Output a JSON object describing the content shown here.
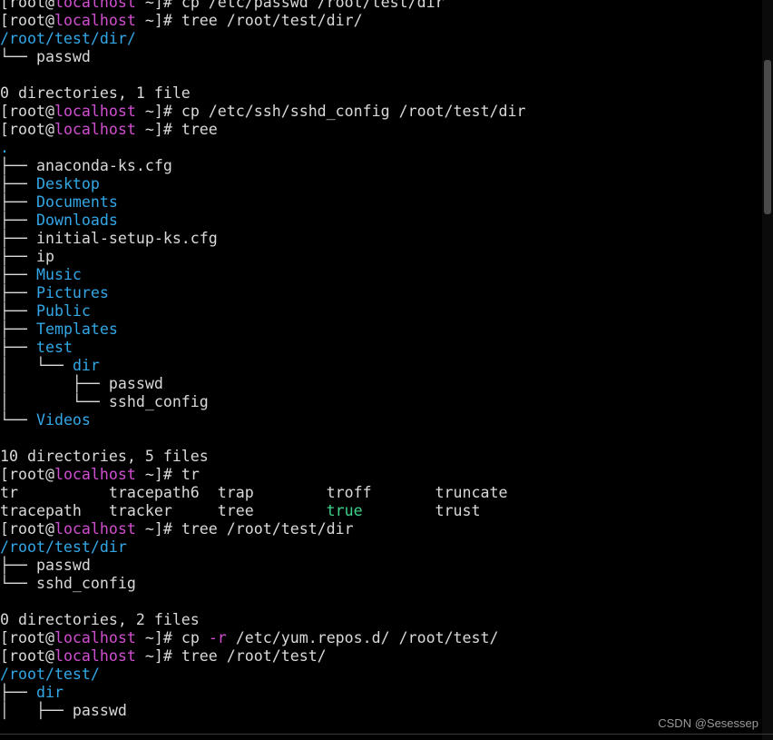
{
  "colors": {
    "default": "#d9d9d9",
    "host": "#d04fd0",
    "dir": "#33a7e6",
    "exec": "#3ed18b"
  },
  "watermark": "CSDN @Sesessep",
  "lines": [
    [
      [
        "[root@",
        "default"
      ],
      [
        "localhost",
        "host"
      ],
      [
        " ~]# cp /etc/passwd /root/test/dir",
        "default"
      ]
    ],
    [
      [
        "[root@",
        "default"
      ],
      [
        "localhost",
        "host"
      ],
      [
        " ~]# tree /root/test/dir/",
        "default"
      ]
    ],
    [
      [
        "/root/test/dir/",
        "dir"
      ]
    ],
    [
      [
        "└── passwd",
        "default"
      ]
    ],
    [
      [
        "",
        "default"
      ]
    ],
    [
      [
        "0 directories, 1 file",
        "default"
      ]
    ],
    [
      [
        "[root@",
        "default"
      ],
      [
        "localhost",
        "host"
      ],
      [
        " ~]# cp /etc/ssh/sshd_config /root/test/dir",
        "default"
      ]
    ],
    [
      [
        "[root@",
        "default"
      ],
      [
        "localhost",
        "host"
      ],
      [
        " ~]# tree",
        "default"
      ]
    ],
    [
      [
        ".",
        "dir"
      ]
    ],
    [
      [
        "├── anaconda-ks.cfg",
        "default"
      ]
    ],
    [
      [
        "├── ",
        "default"
      ],
      [
        "Desktop",
        "dir"
      ]
    ],
    [
      [
        "├── ",
        "default"
      ],
      [
        "Documents",
        "dir"
      ]
    ],
    [
      [
        "├── ",
        "default"
      ],
      [
        "Downloads",
        "dir"
      ]
    ],
    [
      [
        "├── initial-setup-ks.cfg",
        "default"
      ]
    ],
    [
      [
        "├── ip",
        "default"
      ]
    ],
    [
      [
        "├── ",
        "default"
      ],
      [
        "Music",
        "dir"
      ]
    ],
    [
      [
        "├── ",
        "default"
      ],
      [
        "Pictures",
        "dir"
      ]
    ],
    [
      [
        "├── ",
        "default"
      ],
      [
        "Public",
        "dir"
      ]
    ],
    [
      [
        "├── ",
        "default"
      ],
      [
        "Templates",
        "dir"
      ]
    ],
    [
      [
        "├── ",
        "default"
      ],
      [
        "test",
        "dir"
      ]
    ],
    [
      [
        "│   └── ",
        "default"
      ],
      [
        "dir",
        "dir"
      ]
    ],
    [
      [
        "│       ├── passwd",
        "default"
      ]
    ],
    [
      [
        "│       └── sshd_config",
        "default"
      ]
    ],
    [
      [
        "└── ",
        "default"
      ],
      [
        "Videos",
        "dir"
      ]
    ],
    [
      [
        "",
        "default"
      ]
    ],
    [
      [
        "10 directories, 5 files",
        "default"
      ]
    ],
    [
      [
        "[root@",
        "default"
      ],
      [
        "localhost",
        "host"
      ],
      [
        " ~]# tr",
        "default"
      ]
    ],
    [
      [
        "tr          tracepath6  trap        troff       truncate",
        "default"
      ]
    ],
    [
      [
        "tracepath   tracker     tree        ",
        "default"
      ],
      [
        "true",
        "exec"
      ],
      [
        "        trust",
        "default"
      ]
    ],
    [
      [
        "[root@",
        "default"
      ],
      [
        "localhost",
        "host"
      ],
      [
        " ~]# tree /root/test/dir",
        "default"
      ]
    ],
    [
      [
        "/root/test/dir",
        "dir"
      ]
    ],
    [
      [
        "├── passwd",
        "default"
      ]
    ],
    [
      [
        "└── sshd_config",
        "default"
      ]
    ],
    [
      [
        "",
        "default"
      ]
    ],
    [
      [
        "0 directories, 2 files",
        "default"
      ]
    ],
    [
      [
        "[root@",
        "default"
      ],
      [
        "localhost",
        "host"
      ],
      [
        " ~]# cp ",
        "default"
      ],
      [
        "-r",
        "host"
      ],
      [
        " /etc/yum.repos.d/ /root/test/",
        "default"
      ]
    ],
    [
      [
        "[root@",
        "default"
      ],
      [
        "localhost",
        "host"
      ],
      [
        " ~]# tree /root/test/",
        "default"
      ]
    ],
    [
      [
        "/root/test/",
        "dir"
      ]
    ],
    [
      [
        "├── ",
        "default"
      ],
      [
        "dir",
        "dir"
      ]
    ],
    [
      [
        "│   ├── passwd",
        "default"
      ]
    ]
  ]
}
